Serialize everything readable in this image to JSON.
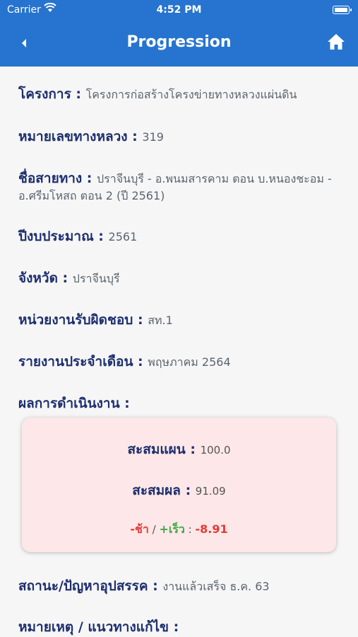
{
  "status_bar": {
    "carrier": "Carrier",
    "time": "4:52 PM"
  },
  "nav": {
    "title": "Progression"
  },
  "fields": {
    "project_label": "โครงการ : ",
    "project_value": "โครงการก่อสร้างโครงข่ายทางหลวงแผ่นดิน",
    "highway_label": "หมายเลขทางหลวง : ",
    "highway_value": "319",
    "route_label": "ชื่อสายทาง : ",
    "route_value": "ปราจีนบุรี - อ.พนมสารคาม ตอน บ.หนองชะอม - อ.ศรีมโหสถ ตอน 2 (ปี 2561)",
    "budget_label": "ปีงบประมาณ : ",
    "budget_value": "2561",
    "province_label": "จังหวัด : ",
    "province_value": "ปราจีนบุรี",
    "agency_label": "หน่วยงานรับผิดชอบ : ",
    "agency_value": "สท.1",
    "report_label": "รายงานประจำเดือน : ",
    "report_value": "พฤษภาคม 2564",
    "performance_label": "ผลการดำเนินงาน :",
    "status_label": "สถานะ/ปัญหาอุปสรรค : ",
    "status_value": "งานแล้วเสร็จ ธ.ค. 63",
    "remark_label": "หมายเหตุ / แนวทางแก้ไข :"
  },
  "performance": {
    "plan_label": "สะสมแผน : ",
    "plan_value": "100.0",
    "result_label": "สะสมผล : ",
    "result_value": "91.09",
    "slow_label": "-ช้า",
    "sep": " / ",
    "fast_label": "+เร็ว",
    "colon": " : ",
    "diff_value": "-8.91"
  },
  "colors": {
    "header": "#2674cf",
    "label": "#1d2f6f",
    "card_bg": "#fde7e8",
    "slow": "#e53935",
    "fast": "#3faa46"
  }
}
